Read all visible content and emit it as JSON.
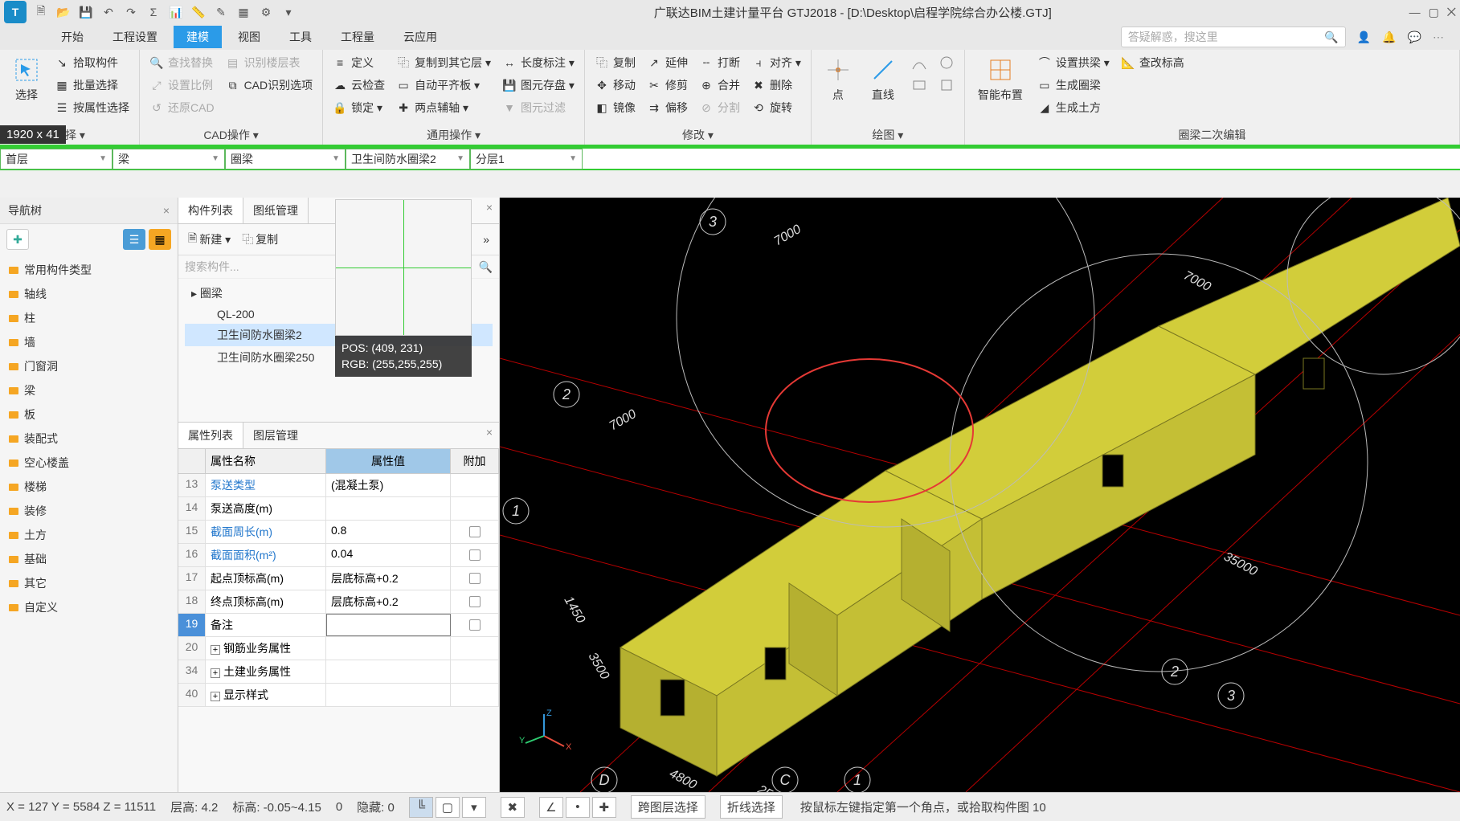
{
  "app": {
    "titlePrefix": "广联达BIM土建计量平台 GTJ2018 - ",
    "filePath": "[D:\\Desktop\\启程学院综合办公楼.GTJ]"
  },
  "menuTabs": [
    "开始",
    "工程设置",
    "建模",
    "视图",
    "工具",
    "工程量",
    "云应用"
  ],
  "menuActive": "建模",
  "menuSearchPlaceholder": "答疑解惑，搜这里",
  "ribbon": {
    "g1": {
      "label": "选择 ▾",
      "big": "选择",
      "items": [
        "拾取构件",
        "批量选择",
        "按属性选择"
      ]
    },
    "g2": {
      "label": "CAD操作 ▾",
      "col1": [
        "查找替换",
        "设置比例",
        "还原CAD"
      ],
      "col2": [
        "识别楼层表",
        "CAD识别选项"
      ]
    },
    "g3": {
      "label": "通用操作 ▾",
      "col1": [
        "定义",
        "云检查",
        "锁定 ▾"
      ],
      "col2": [
        "复制到其它层 ▾",
        "自动平齐板 ▾",
        "两点辅轴 ▾"
      ],
      "col3": [
        "长度标注 ▾",
        "图元存盘 ▾",
        "图元过滤"
      ]
    },
    "g4": {
      "label": "修改 ▾",
      "col1": [
        "复制",
        "移动",
        "镜像"
      ],
      "col2": [
        "延伸",
        "修剪",
        "偏移"
      ],
      "col3": [
        "打断",
        "合并",
        "分割"
      ],
      "col4": [
        "对齐 ▾",
        "删除",
        "旋转"
      ]
    },
    "g5": {
      "label": "绘图 ▾",
      "big1": "点",
      "big2": "直线"
    },
    "g6": {
      "label": "圈梁二次编辑",
      "big": "智能布置",
      "col": [
        "设置拱梁 ▾",
        "生成圈梁",
        "生成土方"
      ],
      "extra": "查改标高"
    }
  },
  "dropdowns": {
    "d1": "首层",
    "d2": "梁",
    "d3": "圈梁",
    "d4": "卫生间防水圈梁2",
    "d5": "分层1"
  },
  "dimBadge": "1920 x 41",
  "navPanel": {
    "title": "导航树",
    "items": [
      "常用构件类型",
      "轴线",
      "柱",
      "墙",
      "门窗洞",
      "梁",
      "板",
      "装配式",
      "空心楼盖",
      "楼梯",
      "装修",
      "土方",
      "基础",
      "其它",
      "自定义"
    ]
  },
  "midPanel": {
    "tabs": [
      "构件列表",
      "图纸管理"
    ],
    "activeTab": "构件列表",
    "tbNew": "新建 ▾",
    "tbCopy": "复制",
    "searchPlaceholder": "搜索构件...",
    "treeParent": "圈梁",
    "treeItems": [
      "QL-200",
      "卫生间防水圈梁2",
      "卫生间防水圈梁250"
    ],
    "treeSel": 1,
    "zoom": {
      "pos": "POS:  (409, 231)",
      "rgb": "RGB:  (255,255,255)"
    }
  },
  "propPanel": {
    "tabs": [
      "属性列表",
      "图层管理"
    ],
    "activeTab": "属性列表",
    "headers": {
      "name": "属性名称",
      "val": "属性值",
      "extra": "附加"
    },
    "rows": [
      {
        "idx": "13",
        "name": "泵送类型",
        "val": "(混凝土泵)",
        "link": true,
        "chk": false,
        "expand": null
      },
      {
        "idx": "14",
        "name": "泵送高度(m)",
        "val": "",
        "link": false,
        "chk": false,
        "expand": null
      },
      {
        "idx": "15",
        "name": "截面周长(m)",
        "val": "0.8",
        "link": true,
        "chk": true,
        "expand": null
      },
      {
        "idx": "16",
        "name": "截面面积(m²)",
        "val": "0.04",
        "link": true,
        "chk": true,
        "expand": null
      },
      {
        "idx": "17",
        "name": "起点顶标高(m)",
        "val": "层底标高+0.2",
        "link": false,
        "chk": true,
        "expand": null
      },
      {
        "idx": "18",
        "name": "终点顶标高(m)",
        "val": "层底标高+0.2",
        "link": false,
        "chk": true,
        "expand": null
      },
      {
        "idx": "19",
        "name": "备注",
        "val": "",
        "link": false,
        "chk": true,
        "expand": null,
        "sel": true
      },
      {
        "idx": "20",
        "name": "钢筋业务属性",
        "val": "",
        "link": false,
        "chk": false,
        "expand": "+"
      },
      {
        "idx": "34",
        "name": "土建业务属性",
        "val": "",
        "link": false,
        "chk": false,
        "expand": "+"
      },
      {
        "idx": "40",
        "name": "显示样式",
        "val": "",
        "link": false,
        "chk": false,
        "expand": "+"
      }
    ]
  },
  "statusbar": {
    "coords": "X = 127 Y = 5584 Z = 11511",
    "floorH": "层高:   4.2",
    "elev": "标高:   -0.05~4.15",
    "zero": "0",
    "hidden": "隐藏:   0",
    "b1": "跨图层选择",
    "b2": "折线选择",
    "hint": "按鼠标左键指定第一个角点，或拾取构件图 10"
  }
}
